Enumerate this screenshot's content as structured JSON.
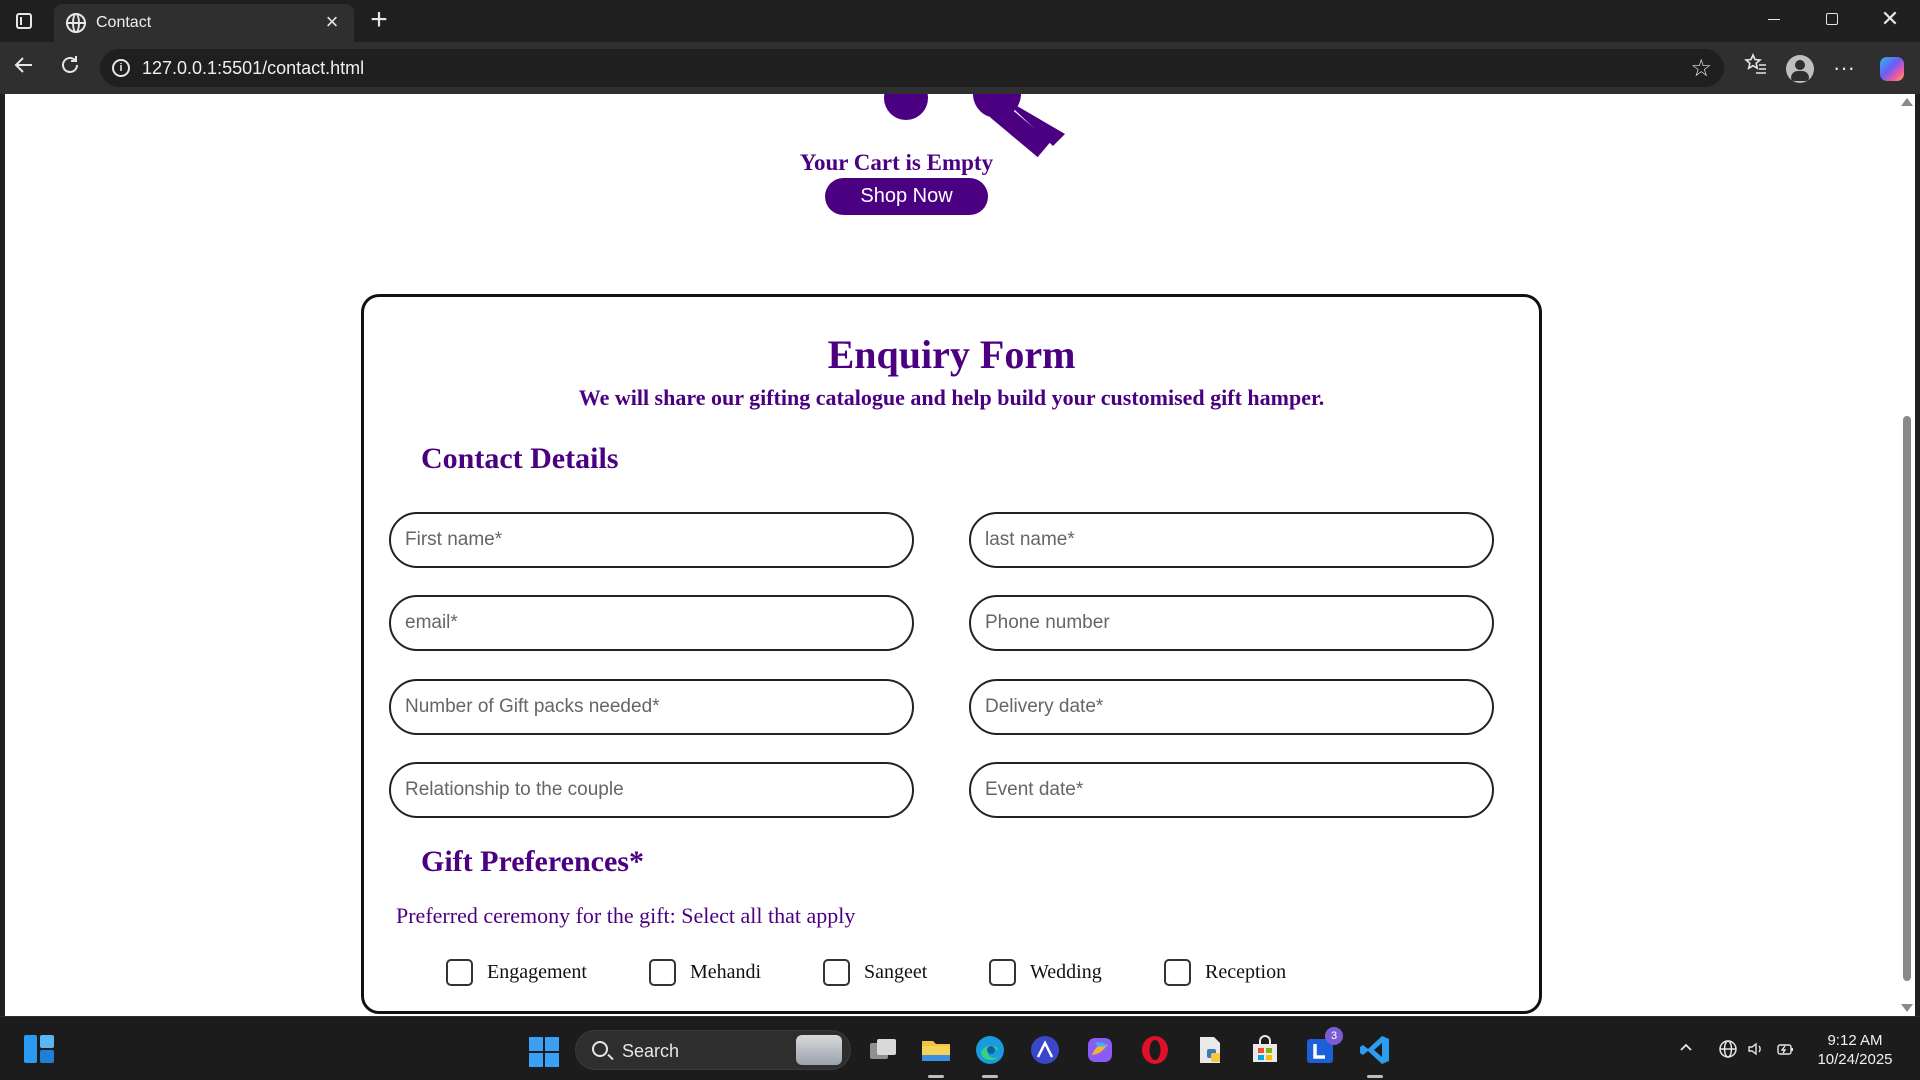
{
  "browser": {
    "tab_title": "Contact",
    "new_tab_glyph": "+",
    "close_tab_glyph": "×",
    "url": "127.0.0.1:5501/contact.html",
    "window_controls": {
      "minimize": "minimize-icon",
      "maximize": "maximize-icon",
      "close": "✕"
    }
  },
  "cart": {
    "empty_text": "Your Cart is Empty",
    "shop_button": "Shop Now",
    "accent_color": "#4b0082"
  },
  "form": {
    "title": "Enquiry Form",
    "subtitle": "We will share our gifting catalogue and help build your customised gift hamper.",
    "contact_section": "Contact Details",
    "fields": {
      "first_name": {
        "placeholder": "First name*",
        "value": ""
      },
      "last_name": {
        "placeholder": "last name*",
        "value": ""
      },
      "email": {
        "placeholder": "email*",
        "value": ""
      },
      "phone": {
        "placeholder": "Phone number",
        "value": ""
      },
      "gift_packs": {
        "placeholder": "Number of Gift packs needed*",
        "value": ""
      },
      "delivery_date": {
        "placeholder": "Delivery date*",
        "value": ""
      },
      "relationship": {
        "placeholder": "Relationship to the couple",
        "value": ""
      },
      "event_date": {
        "placeholder": "Event date*",
        "value": ""
      }
    },
    "gift_section": "Gift Preferences*",
    "ceremony_prompt": "Preferred ceremony for the gift: Select all that apply",
    "ceremonies": [
      {
        "label": "Engagement",
        "checked": false
      },
      {
        "label": "Mehandi",
        "checked": false
      },
      {
        "label": "Sangeet",
        "checked": false
      },
      {
        "label": "Wedding",
        "checked": false
      },
      {
        "label": "Reception",
        "checked": false
      }
    ]
  },
  "taskbar": {
    "search_label": "Search",
    "notification_badge": "3",
    "time": "9:12 AM",
    "date": "10/24/2025"
  }
}
